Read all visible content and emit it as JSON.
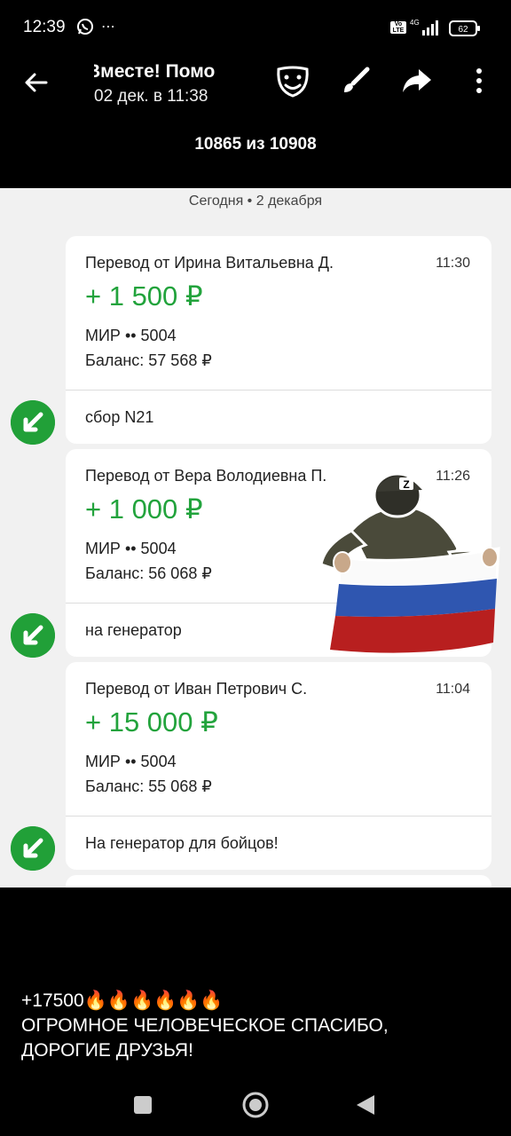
{
  "status_bar": {
    "time": "12:39",
    "more": "⋯",
    "network": "4G",
    "battery": "62"
  },
  "app_bar": {
    "title": "Вместе! Помо",
    "subtitle": "02 дек. в 11:38",
    "counter": "10865 из 10908"
  },
  "screenshot": {
    "date_label": "Сегодня • 2 декабря",
    "transactions": [
      {
        "title": "Перевод от Ирина Витальевна Д.",
        "time": "11:30",
        "amount": "+ 1 500 ₽",
        "card": "МИР •• 5004",
        "balance": "Баланс: 57 568 ₽",
        "note": "сбор N21"
      },
      {
        "title": "Перевод от Вера Володиевна П.",
        "time": "11:26",
        "amount": "+ 1 000 ₽",
        "card": "МИР •• 5004",
        "balance": "Баланс: 56 068 ₽",
        "note": "на генератор"
      },
      {
        "title": "Перевод от Иван Петрович С.",
        "time": "11:04",
        "amount": "+ 15 000 ₽",
        "card": "МИР •• 5004",
        "balance": "Баланс: 55 068 ₽",
        "note": "На генератор для бойцов!"
      }
    ],
    "sticker_letter": "Z"
  },
  "caption": {
    "amount": "+17500",
    "fire": "🔥🔥🔥🔥🔥🔥",
    "line1": "ОГРОМНОЕ ЧЕЛОВЕЧЕСКОЕ СПАСИБО,",
    "line2": "ДОРОГИЕ ДРУЗЬЯ!"
  },
  "colors": {
    "accent_green": "#21a038",
    "amount_green": "#22a33c"
  }
}
